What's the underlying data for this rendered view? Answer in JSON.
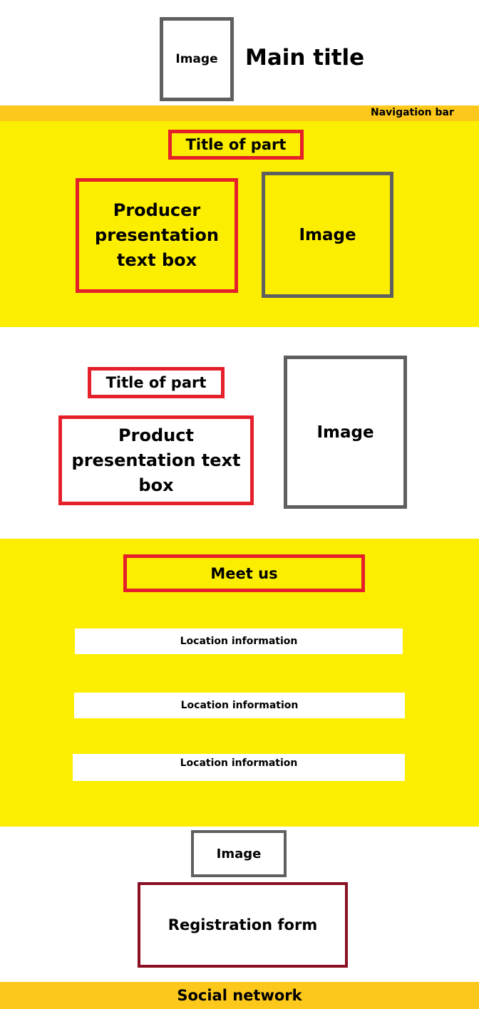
{
  "header": {
    "image_label": "Image",
    "main_title": "Main title"
  },
  "navigation": {
    "label": "Navigation bar"
  },
  "producer_section": {
    "title": "Title of part",
    "text_box": "Producer presentation text box",
    "image_label": "Image"
  },
  "product_section": {
    "title": "Title of part",
    "text_box": "Product presentation text box",
    "image_label": "Image"
  },
  "meet_section": {
    "title": "Meet us",
    "locations": [
      "Location information",
      "Location information",
      "Location information"
    ]
  },
  "footer": {
    "image_label": "Image",
    "registration_form": "Registration form",
    "social_network": "Social network"
  },
  "colors": {
    "section_yellow": "#fcee00",
    "bar_orange": "#fcc81c",
    "text_box_border": "#e5202a",
    "image_border": "#5f5f5f",
    "form_border": "#8b0f22"
  }
}
